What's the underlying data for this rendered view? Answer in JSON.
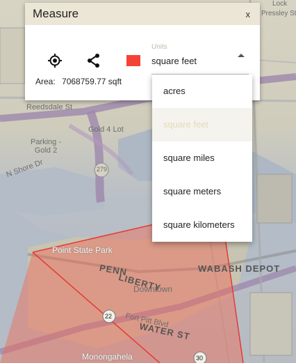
{
  "dialog": {
    "title": "Measure",
    "close_label": "x",
    "units_label": "Units",
    "units_value": "square feet",
    "area_label": "Area:",
    "area_value": "7068759.77 sqft",
    "swatch_color": "#f44336"
  },
  "dropdown": {
    "options": [
      "acres",
      "square feet",
      "square miles",
      "square meters",
      "square kilometers"
    ],
    "selected": "square feet"
  },
  "map": {
    "labels": {
      "reedsdale": "Reedsdale St",
      "gold4": "Gold 4 Lot",
      "parking_gold2": "Parking - Gold 2",
      "shore_dr": "N Shore Dr",
      "point_state_park": "Point State Park",
      "downtown": "Downtown",
      "wabash_depot": "WABASH DEPOT",
      "fort_pitt": "Fort Pitt Blvd",
      "monongahela": "Monongahela",
      "penn": "PENN",
      "liberty": "LIBERTY",
      "water_st": "WATER ST",
      "shield_279": "279",
      "shield_22": "22",
      "shield_30": "30",
      "pressley": "Pressley St",
      "lock": "Lock"
    },
    "polygon_color": "#e53935"
  }
}
